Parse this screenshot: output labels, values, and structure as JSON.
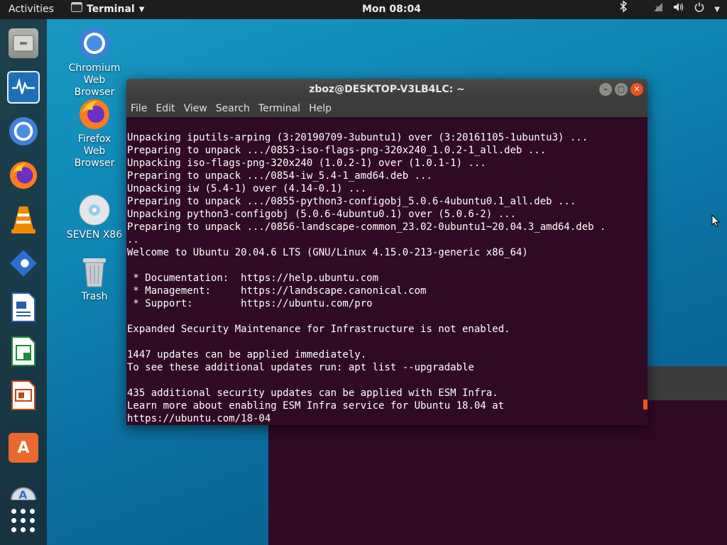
{
  "topbar": {
    "activities": "Activities",
    "app_menu": "Terminal",
    "clock": "Mon 08:04"
  },
  "desktop_icons": [
    {
      "label_lines": [
        "Chromium",
        "Web",
        "Browser"
      ]
    },
    {
      "label_lines": [
        "Firefox",
        "Web",
        "Browser"
      ]
    },
    {
      "label_lines": [
        "SEVEN X86"
      ]
    },
    {
      "label_lines": [
        "Trash"
      ]
    }
  ],
  "terminal": {
    "title": "zboz@DESKTOP-V3LB4LC: ~",
    "menu": [
      "File",
      "Edit",
      "View",
      "Search",
      "Terminal",
      "Help"
    ],
    "lines": [
      "Unpacking iputils-arping (3:20190709-3ubuntu1) over (3:20161105-1ubuntu3) ...",
      "Preparing to unpack .../0853-iso-flags-png-320x240_1.0.2-1_all.deb ...",
      "Unpacking iso-flags-png-320x240 (1.0.2-1) over (1.0.1-1) ...",
      "Preparing to unpack .../0854-iw_5.4-1_amd64.deb ...",
      "Unpacking iw (5.4-1) over (4.14-0.1) ...",
      "Preparing to unpack .../0855-python3-configobj_5.0.6-4ubuntu0.1_all.deb ...",
      "Unpacking python3-configobj (5.0.6-4ubuntu0.1) over (5.0.6-2) ...",
      "Preparing to unpack .../0856-landscape-common_23.02-0ubuntu1~20.04.3_amd64.deb .",
      "..",
      "Welcome to Ubuntu 20.04.6 LTS (GNU/Linux 4.15.0-213-generic x86_64)",
      "",
      " * Documentation:  https://help.ubuntu.com",
      " * Management:     https://landscape.canonical.com",
      " * Support:        https://ubuntu.com/pro",
      "",
      "Expanded Security Maintenance for Infrastructure is not enabled.",
      "",
      "1447 updates can be applied immediately.",
      "To see these additional updates run: apt list --upgradable",
      "",
      "435 additional security updates can be applied with ESM Infra.",
      "Learn more about enabling ESM Infra service for Ubuntu 18.04 at",
      "https://ubuntu.com/18-04"
    ]
  },
  "dock": {
    "apps": [
      "files-icon",
      "system-monitor-icon",
      "chromium-icon",
      "firefox-icon",
      "vlc-icon",
      "remmina-icon",
      "libreoffice-writer-icon",
      "libreoffice-calc-icon",
      "libreoffice-impress-icon",
      "software-center-icon",
      "software-updater-icon"
    ]
  },
  "colors": {
    "terminal_bg": "#300a24",
    "accent": "#e95420",
    "topbar": "#1d1d1d"
  }
}
